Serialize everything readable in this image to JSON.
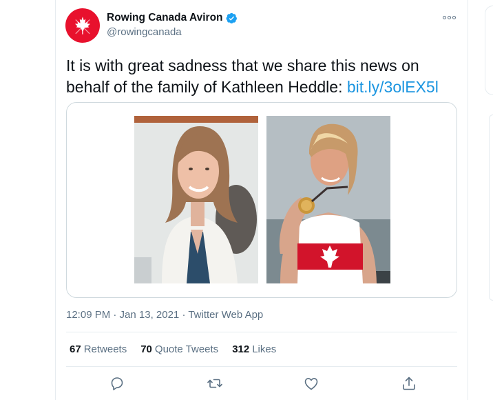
{
  "account": {
    "display_name": "Rowing Canada Aviron",
    "handle": "@rowingcanada",
    "verified": true,
    "avatar_icon": "maple-leaf-oars-icon",
    "brand_color": "#e8112d"
  },
  "tweet": {
    "text_before_link": "It is with great sadness that we share this news on behalf of the family of Kathleen Heddle: ",
    "link_text": "bit.ly/3olEX5l",
    "link_color": "#1b95e0"
  },
  "media": {
    "photos": [
      {
        "name": "portrait-white-blazer"
      },
      {
        "name": "athlete-with-medal"
      }
    ]
  },
  "meta": {
    "timestamp": "12:09 PM · Jan 13, 2021 · Twitter Web App"
  },
  "stats": {
    "retweets_count": "67",
    "retweets_label": "Retweets",
    "quotes_count": "70",
    "quotes_label": "Quote Tweets",
    "likes_count": "312",
    "likes_label": "Likes"
  },
  "actions": {
    "reply_icon": "reply-icon",
    "retweet_icon": "retweet-icon",
    "like_icon": "heart-icon",
    "share_icon": "share-icon"
  }
}
